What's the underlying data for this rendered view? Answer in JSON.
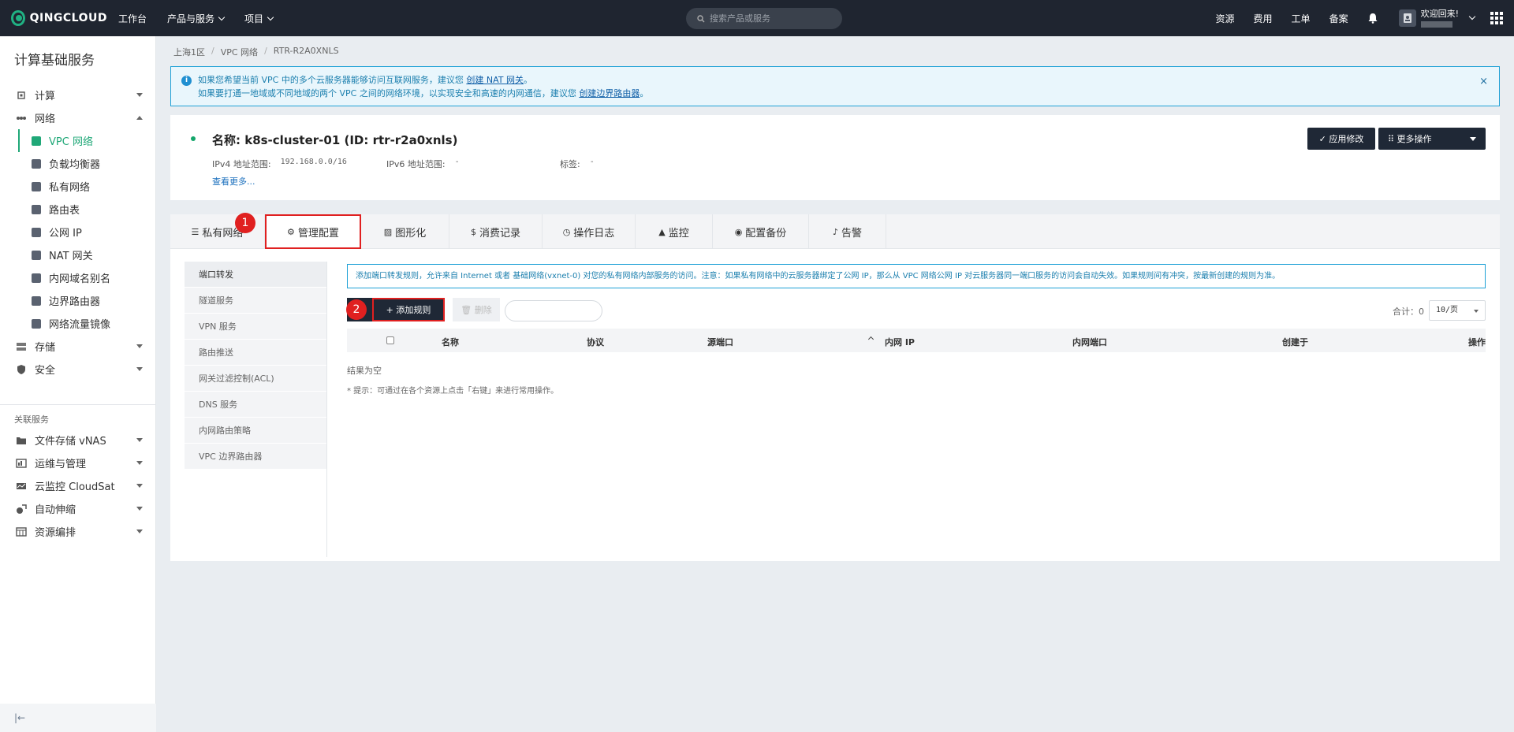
{
  "topbar": {
    "logo": "QINGCLOUD",
    "nav": [
      {
        "label": "工作台",
        "dropdown": false
      },
      {
        "label": "产品与服务",
        "dropdown": true
      },
      {
        "label": "项目",
        "dropdown": true
      }
    ],
    "search_placeholder": "搜索产品或服务",
    "right_links": [
      "资源",
      "费用",
      "工单",
      "备案"
    ],
    "welcome": "欢迎回来!"
  },
  "sidebar": {
    "title": "计算基础服务",
    "groups_top": [
      {
        "label": "计算",
        "icon": "chip-icon",
        "expanded": false
      },
      {
        "label": "网络",
        "icon": "network-icon",
        "expanded": true
      }
    ],
    "network_items": [
      {
        "label": "VPC 网络",
        "icon": "vpc-icon",
        "active": true
      },
      {
        "label": "负载均衡器",
        "icon": "load-balancer-icon",
        "active": false
      },
      {
        "label": "私有网络",
        "icon": "private-network-icon",
        "active": false
      },
      {
        "label": "路由表",
        "icon": "route-table-icon",
        "active": false
      },
      {
        "label": "公网 IP",
        "icon": "public-ip-icon",
        "active": false
      },
      {
        "label": "NAT 网关",
        "icon": "nat-gateway-icon",
        "active": false
      },
      {
        "label": "内网域名别名",
        "icon": "dns-alias-icon",
        "active": false
      },
      {
        "label": "边界路由器",
        "icon": "border-router-icon",
        "active": false
      },
      {
        "label": "网络流量镜像",
        "icon": "traffic-mirror-icon",
        "active": false
      }
    ],
    "groups_bottom": [
      {
        "label": "存储",
        "icon": "storage-icon"
      },
      {
        "label": "安全",
        "icon": "shield-icon"
      }
    ],
    "related_label": "关联服务",
    "related": [
      {
        "label": "文件存储 vNAS",
        "icon": "folder-icon"
      },
      {
        "label": "运维与管理",
        "icon": "ops-icon"
      },
      {
        "label": "云监控 CloudSat",
        "icon": "monitor-icon"
      },
      {
        "label": "自动伸缩",
        "icon": "autoscale-icon"
      },
      {
        "label": "资源编排",
        "icon": "orchestration-icon"
      }
    ],
    "collapse_label": "|←"
  },
  "breadcrumb": [
    "上海1区",
    "VPC 网络",
    "RTR-R2A0XNLS"
  ],
  "notice": {
    "line1_prefix": "如果您希望当前 VPC 中的多个云服务器能够访问互联网服务，建议您",
    "line1_link": "创建 NAT 网关",
    "line1_suffix": "。",
    "line2_prefix": "如果要打通一地域或不同地域的两个 VPC 之间的网络环境，以实现安全和高速的内网通信，建议您",
    "line2_link": "创建边界路由器",
    "line2_suffix": "。",
    "close": "×"
  },
  "resource": {
    "name": "名称: k8s-cluster-01 (ID: rtr-r2a0xnls)",
    "ipv4_label": "IPv4 地址范围:",
    "ipv4_value": "192.168.0.0/16",
    "ipv6_label": "IPv6 地址范围:",
    "ipv6_value": "-",
    "tag_label": "标签:",
    "tag_value": "-",
    "more": "查看更多...",
    "apply_button": "✓ 应用修改",
    "more_ops_button": "⠿ 更多操作"
  },
  "tabs": [
    {
      "label": "私有网络",
      "icon": "☰",
      "active": false
    },
    {
      "label": "管理配置",
      "icon": "⚙",
      "active": true
    },
    {
      "label": "图形化",
      "icon": "▨",
      "active": false
    },
    {
      "label": "消费记录",
      "icon": "$",
      "active": false
    },
    {
      "label": "操作日志",
      "icon": "◷",
      "active": false
    },
    {
      "label": "监控",
      "icon": "▲",
      "active": false
    },
    {
      "label": "配置备份",
      "icon": "◉",
      "active": false
    },
    {
      "label": "告警",
      "icon": "♪",
      "active": false
    }
  ],
  "badges": [
    "1",
    "2"
  ],
  "left_menu": [
    {
      "label": "端口转发",
      "active": true
    },
    {
      "label": "隧道服务",
      "active": false
    },
    {
      "label": "VPN 服务",
      "active": false
    },
    {
      "label": "路由推送",
      "active": false
    },
    {
      "label": "网关过滤控制(ACL)",
      "active": false
    },
    {
      "label": "DNS 服务",
      "active": false
    },
    {
      "label": "内网路由策略",
      "active": false
    },
    {
      "label": "VPC 边界路由器",
      "active": false
    }
  ],
  "content_notice": "添加端口转发规则，允许来自 Internet 或者 基础网络(vxnet-0) 对您的私有网络内部服务的访问。注意：如果私有网络中的云服务器绑定了公网 IP，那么从 VPC 网络公网 IP 对云服务器同一端口服务的访问会自动失效。如果规则间有冲突，按最新创建的规则为准。",
  "toolbar": {
    "add_rule": "+ 添加规则",
    "delete": "🗑 删除",
    "total": "合计：0",
    "page_size": "10/页"
  },
  "table": {
    "columns": [
      "名称",
      "协议",
      "源端口",
      "内网 IP",
      "内网端口",
      "创建于",
      "操作"
    ],
    "empty": "结果为空",
    "tip": "* 提示：可通过在各个资源上点击「右键」来进行常用操作。"
  },
  "colors": {
    "topbar": "#1f2530",
    "accent_green": "#20a878",
    "highlight_red": "#e02020",
    "info_blue": "#1fa1d6"
  }
}
